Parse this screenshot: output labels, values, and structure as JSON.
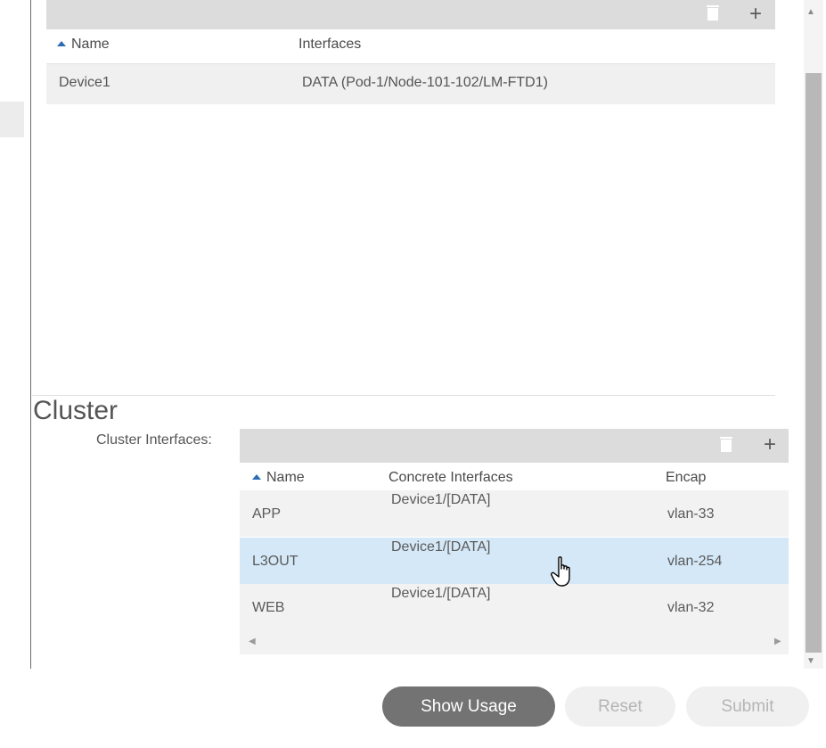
{
  "top_table": {
    "columns": [
      "Name",
      "Interfaces"
    ],
    "rows": [
      {
        "name": "Device1",
        "interfaces": "DATA (Pod-1/Node-101-102/LM-FTD1)"
      }
    ]
  },
  "cluster": {
    "title": "Cluster",
    "interfaces_label": "Cluster Interfaces:",
    "columns": [
      "Name",
      "Concrete Interfaces",
      "Encap"
    ],
    "rows": [
      {
        "name": "APP",
        "concrete": "Device1/[DATA]",
        "encap": "vlan-33"
      },
      {
        "name": "L3OUT",
        "concrete": "Device1/[DATA]",
        "encap": "vlan-254"
      },
      {
        "name": "WEB",
        "concrete": "Device1/[DATA]",
        "encap": "vlan-32"
      }
    ],
    "selected_row": "L3OUT"
  },
  "buttons": {
    "show_usage": "Show Usage",
    "reset": "Reset",
    "submit": "Submit"
  },
  "icons": {
    "delete": "trash-icon",
    "add": "plus-icon",
    "sort": "sort-ascending-icon",
    "cursor": "hand-pointer-cursor"
  },
  "colors": {
    "selected_row": "#d5e8f7",
    "toolbar": "#dcdcdc",
    "primary_button": "#737373",
    "sort_arrow": "#2b6cb3"
  }
}
